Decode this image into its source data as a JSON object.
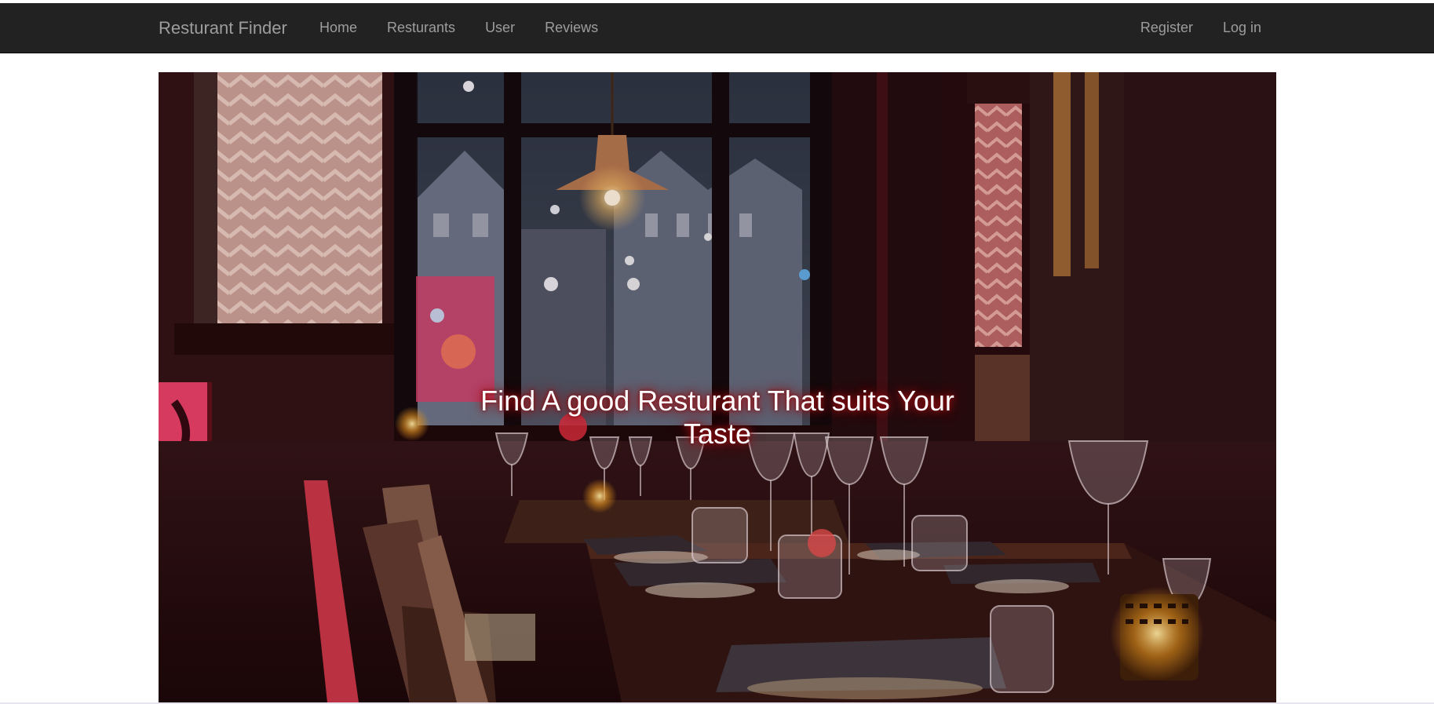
{
  "navbar": {
    "brand": "Resturant Finder",
    "links": [
      "Home",
      "Resturants",
      "User",
      "Reviews"
    ],
    "auth": {
      "register": "Register",
      "login": "Log in"
    }
  },
  "hero": {
    "title": "Find A good Resturant That suits Your Taste",
    "image": "restaurant-interior-photo"
  },
  "colors": {
    "navbar_bg": "#222222",
    "nav_text": "#9d9d9d",
    "hero_text": "#ffffff",
    "hero_glow": "#b0151a"
  }
}
